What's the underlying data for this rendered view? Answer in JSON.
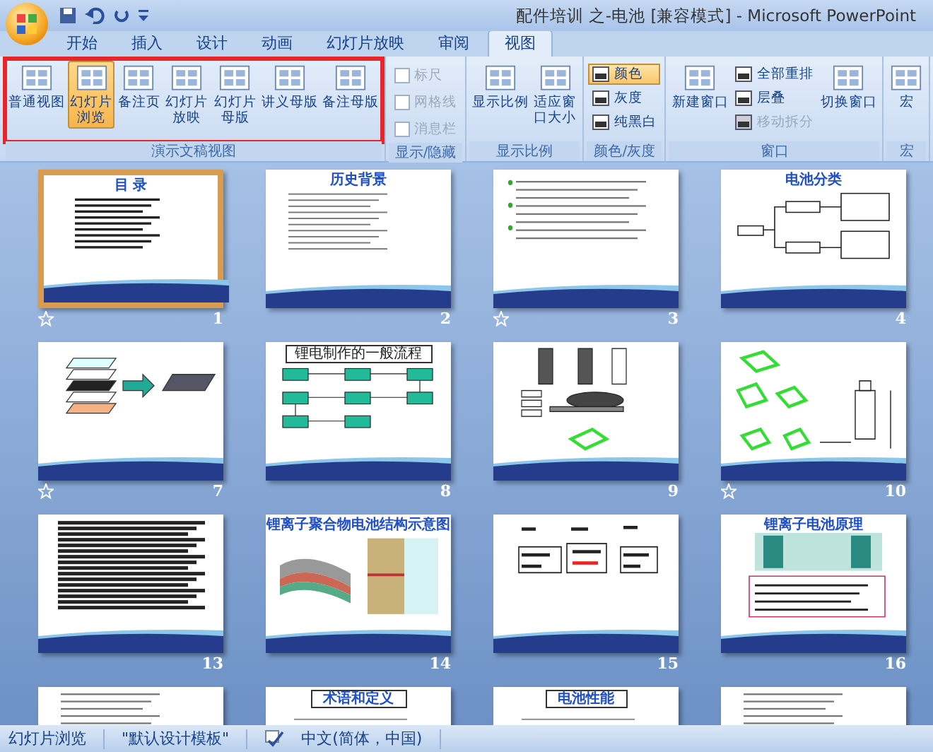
{
  "window": {
    "title": "配件培训 之-电池 [兼容模式] - Microsoft PowerPoint"
  },
  "tabs": [
    {
      "label": "开始",
      "selected": false
    },
    {
      "label": "插入",
      "selected": false
    },
    {
      "label": "设计",
      "selected": false
    },
    {
      "label": "动画",
      "selected": false
    },
    {
      "label": "幻灯片放映",
      "selected": false
    },
    {
      "label": "审阅",
      "selected": false
    },
    {
      "label": "视图",
      "selected": true
    }
  ],
  "ribbon": {
    "groups": [
      {
        "label": "演示文稿视图",
        "highlighted": true,
        "items": [
          {
            "kind": "large",
            "label": "普通视图",
            "selected": false
          },
          {
            "kind": "large",
            "label": "幻灯片浏览",
            "selected": true
          },
          {
            "kind": "large",
            "label": "备注页",
            "selected": false
          },
          {
            "kind": "large",
            "label": "幻灯片放映",
            "selected": false
          },
          {
            "kind": "large",
            "label": "幻灯片母版",
            "selected": false
          },
          {
            "kind": "large",
            "label": "讲义母版",
            "selected": false
          },
          {
            "kind": "large",
            "label": "备注母版",
            "selected": false
          }
        ]
      },
      {
        "label": "显示/隐藏",
        "highlighted": false,
        "items": [
          {
            "kind": "stack",
            "items": [
              {
                "kind": "check",
                "label": "标尺",
                "checked": false,
                "disabled": true
              },
              {
                "kind": "check",
                "label": "网格线",
                "checked": false,
                "disabled": true
              },
              {
                "kind": "check",
                "label": "消息栏",
                "checked": false,
                "disabled": true
              }
            ]
          }
        ]
      },
      {
        "label": "显示比例",
        "highlighted": false,
        "items": [
          {
            "kind": "large",
            "label": "显示比例",
            "selected": false
          },
          {
            "kind": "large",
            "label": "适应窗口大小",
            "selected": false
          }
        ]
      },
      {
        "label": "颜色/灰度",
        "highlighted": false,
        "items": [
          {
            "kind": "stack",
            "items": [
              {
                "kind": "small",
                "label": "颜色",
                "selected": true,
                "disabled": false
              },
              {
                "kind": "small",
                "label": "灰度",
                "selected": false,
                "disabled": false
              },
              {
                "kind": "small",
                "label": "纯黑白",
                "selected": false,
                "disabled": false
              }
            ]
          }
        ]
      },
      {
        "label": "窗口",
        "highlighted": false,
        "items": [
          {
            "kind": "large",
            "label": "新建窗口",
            "selected": false
          },
          {
            "kind": "stack",
            "items": [
              {
                "kind": "small",
                "label": "全部重排",
                "selected": false,
                "disabled": false
              },
              {
                "kind": "small",
                "label": "层叠",
                "selected": false,
                "disabled": false
              },
              {
                "kind": "small",
                "label": "移动拆分",
                "selected": false,
                "disabled": true
              }
            ]
          },
          {
            "kind": "large",
            "label": "切换窗口",
            "selected": false
          }
        ]
      },
      {
        "label": "宏",
        "highlighted": false,
        "items": [
          {
            "kind": "large",
            "label": "宏",
            "selected": false
          }
        ]
      }
    ]
  },
  "slides": [
    {
      "number": "1",
      "selected": true,
      "animated": true,
      "kind": "toc",
      "title": "目 录"
    },
    {
      "number": "2",
      "selected": false,
      "animated": false,
      "kind": "bullets",
      "title": "历史背景"
    },
    {
      "number": "3",
      "selected": false,
      "animated": true,
      "kind": "green_list"
    },
    {
      "number": "4",
      "selected": false,
      "animated": false,
      "kind": "tree",
      "title": "电池分类"
    },
    {
      "number": "7",
      "selected": false,
      "animated": true,
      "kind": "layers"
    },
    {
      "number": "8",
      "selected": false,
      "animated": false,
      "kind": "flow",
      "title": "锂电制作的一般流程"
    },
    {
      "number": "9",
      "selected": false,
      "animated": false,
      "kind": "drawing"
    },
    {
      "number": "10",
      "selected": false,
      "animated": true,
      "kind": "green_drawing"
    },
    {
      "number": "13",
      "selected": false,
      "animated": false,
      "kind": "dense_text"
    },
    {
      "number": "14",
      "selected": false,
      "animated": false,
      "kind": "figure",
      "title": "锂离子聚合物电池结构示意图"
    },
    {
      "number": "15",
      "selected": false,
      "animated": false,
      "kind": "table"
    },
    {
      "number": "16",
      "selected": false,
      "animated": false,
      "kind": "principle",
      "title": "锂离子电池原理"
    },
    {
      "selected": false,
      "kind": "bullets"
    },
    {
      "selected": false,
      "kind": "boxed",
      "title": "术语和定义"
    },
    {
      "selected": false,
      "kind": "boxed",
      "title": "电池性能"
    },
    {
      "selected": false,
      "kind": "bullets"
    }
  ],
  "status_bar": {
    "view": "幻灯片浏览",
    "theme": "\"默认设计模板\"",
    "language": "中文(简体，中国)"
  }
}
